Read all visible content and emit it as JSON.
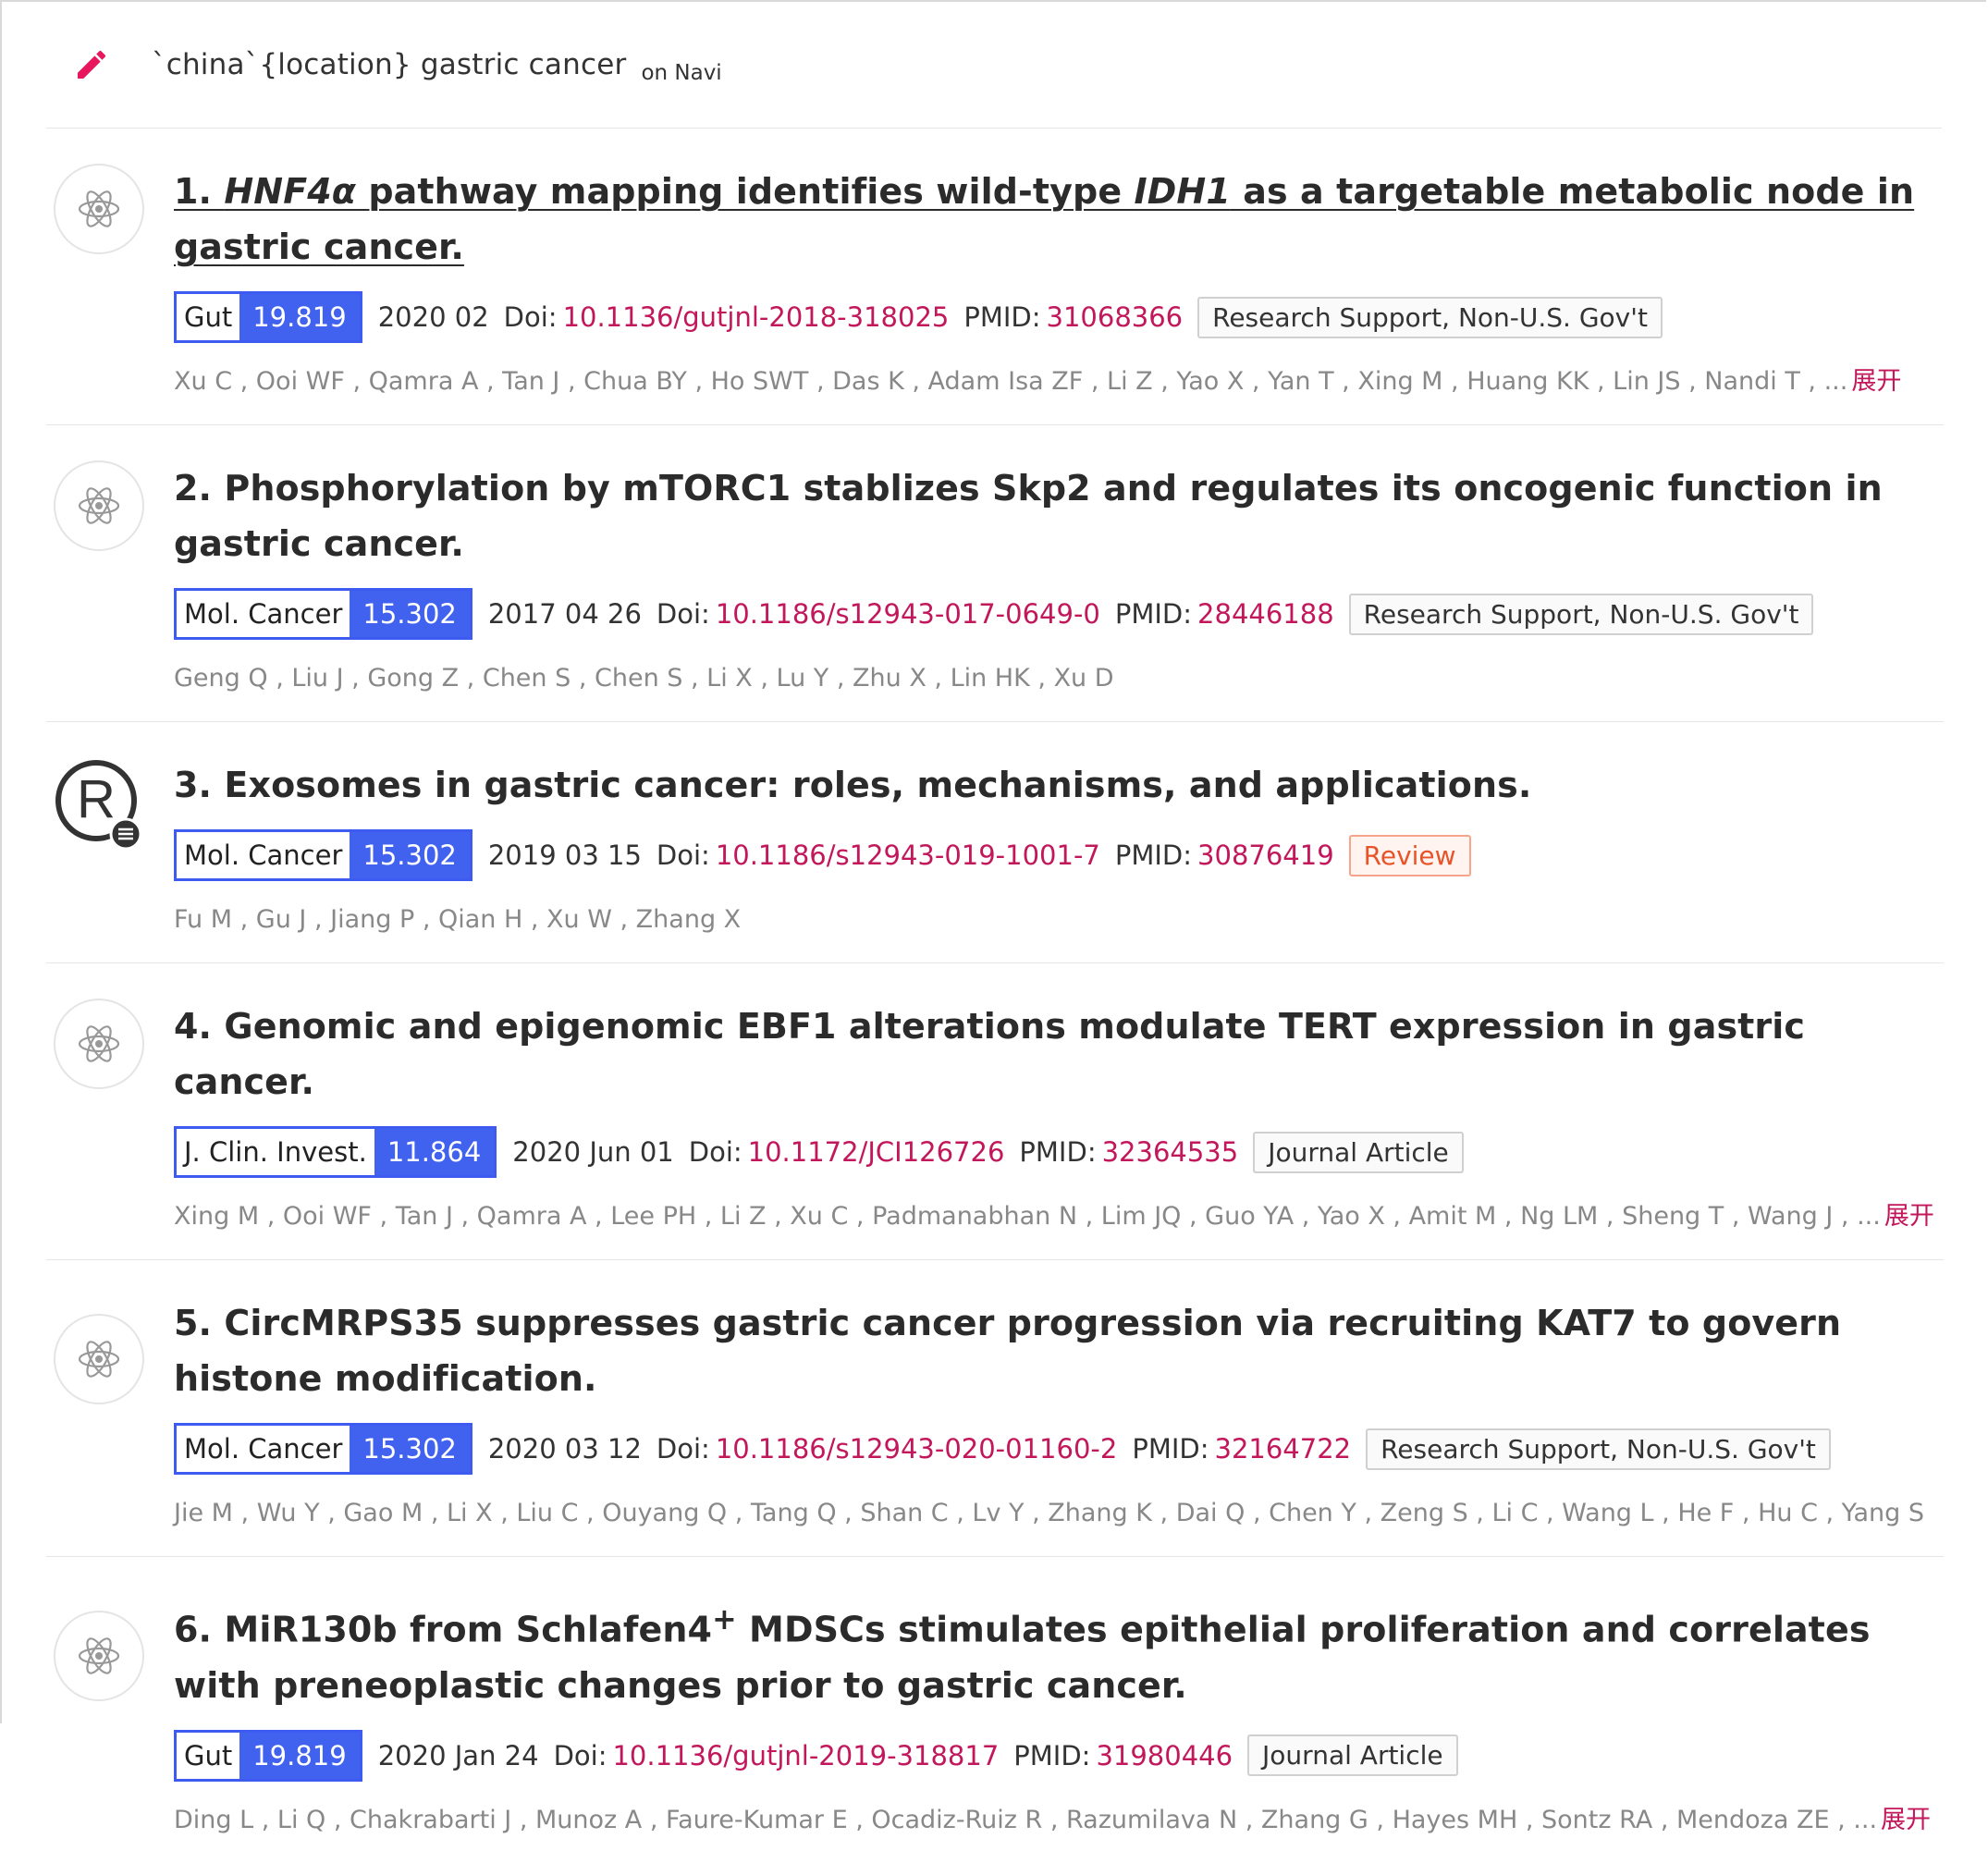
{
  "query": {
    "icon": "pencil-icon",
    "text": "`china`{location} gastric cancer",
    "suffix": "on Navi"
  },
  "colors": {
    "accent_red": "#e8175d",
    "journal_blue": "#4062ef",
    "link_crimson": "#c2185b",
    "muted_gray": "#888888"
  },
  "labels": {
    "doi": "Doi:",
    "pmid": "PMID:"
  },
  "results": [
    {
      "icon": "atom-icon",
      "title_parts": [
        {
          "t": "1. ",
          "style": "normal"
        },
        {
          "t": "HNF4α",
          "style": "italic"
        },
        {
          "t": " pathway mapping identifies wild-type ",
          "style": "normal"
        },
        {
          "t": "IDH1",
          "style": "italic"
        },
        {
          "t": " as a targetable metabolic node in ",
          "style": "normal"
        },
        {
          "t": "gastric cancer.",
          "style": "bold"
        }
      ],
      "linked": true,
      "journal": "Gut",
      "impact": "19.819",
      "date": "2020 02",
      "doi": "10.1136/gutjnl-2018-318025",
      "pmid": "31068366",
      "type": "Research Support, Non-U.S. Gov't",
      "type_style": "default",
      "authors": "Xu C , Ooi WF , Qamra A , Tan J , Chua BY , Ho SWT , Das K , Adam Isa ZF , Li Z , Yao X , Yan T , Xing M , Huang KK , Lin JS , Nandi T , ...",
      "expand": "展开"
    },
    {
      "icon": "atom-icon",
      "title_parts": [
        {
          "t": "2. Phosphorylation by mTORC1 stablizes Skp2 and regulates its oncogenic function in ",
          "style": "normal"
        },
        {
          "t": "gastric cancer.",
          "style": "bold"
        }
      ],
      "linked": false,
      "journal": "Mol. Cancer",
      "impact": "15.302",
      "date": "2017 04 26",
      "doi": "10.1186/s12943-017-0649-0",
      "pmid": "28446188",
      "type": "Research Support, Non-U.S. Gov't",
      "type_style": "default",
      "authors": "Geng Q , Liu J , Gong Z , Chen S , Chen S , Li X , Lu Y , Zhu X , Lin HK , Xu D",
      "expand": ""
    },
    {
      "icon": "review-registered-icon",
      "title_parts": [
        {
          "t": "3. Exosomes in ",
          "style": "normal"
        },
        {
          "t": "gastric cancer:",
          "style": "bold"
        },
        {
          "t": " roles, mechanisms, and applications.",
          "style": "normal"
        }
      ],
      "linked": false,
      "journal": "Mol. Cancer",
      "impact": "15.302",
      "date": "2019 03 15",
      "doi": "10.1186/s12943-019-1001-7",
      "pmid": "30876419",
      "type": "Review",
      "type_style": "review",
      "authors": "Fu M , Gu J , Jiang P , Qian H , Xu W , Zhang X",
      "expand": ""
    },
    {
      "icon": "atom-icon",
      "title_parts": [
        {
          "t": "4. Genomic and epigenomic EBF1 alterations modulate TERT expression in ",
          "style": "normal"
        },
        {
          "t": "gastric cancer.",
          "style": "bold"
        }
      ],
      "linked": false,
      "journal": "J. Clin. Invest.",
      "impact": "11.864",
      "date": "2020 Jun 01",
      "doi": "10.1172/JCI126726",
      "pmid": "32364535",
      "type": "Journal Article",
      "type_style": "default",
      "authors": "Xing M , Ooi WF , Tan J , Qamra A , Lee PH , Li Z , Xu C , Padmanabhan N , Lim JQ , Guo YA , Yao X , Amit M , Ng LM , Sheng T , Wang J , ...",
      "expand": "展开"
    },
    {
      "icon": "atom-icon",
      "title_parts": [
        {
          "t": "5. CircMRPS35 suppresses ",
          "style": "normal"
        },
        {
          "t": "gastric cancer",
          "style": "bold"
        },
        {
          "t": " progression via recruiting KAT7 to govern histone modification.",
          "style": "normal"
        }
      ],
      "linked": false,
      "journal": "Mol. Cancer",
      "impact": "15.302",
      "date": "2020 03 12",
      "doi": "10.1186/s12943-020-01160-2",
      "pmid": "32164722",
      "type": "Research Support, Non-U.S. Gov't",
      "type_style": "default",
      "authors": "Jie M , Wu Y , Gao M , Li X , Liu C , Ouyang Q , Tang Q , Shan C , Lv Y , Zhang K , Dai Q , Chen Y , Zeng S , Li C , Wang L , He F , Hu C , Yang S",
      "expand": ""
    },
    {
      "icon": "atom-icon",
      "title_parts": [
        {
          "t": "6. MiR130b from Schlafen4",
          "style": "normal"
        },
        {
          "t": "+",
          "style": "sup"
        },
        {
          "t": " MDSCs stimulates epithelial proliferation and correlates with preneoplastic changes prior to ",
          "style": "normal"
        },
        {
          "t": "gastric cancer.",
          "style": "bold"
        }
      ],
      "linked": false,
      "journal": "Gut",
      "impact": "19.819",
      "date": "2020 Jan 24",
      "doi": "10.1136/gutjnl-2019-318817",
      "pmid": "31980446",
      "type": "Journal Article",
      "type_style": "default",
      "authors": "Ding L , Li Q , Chakrabarti J , Munoz A , Faure-Kumar E , Ocadiz-Ruiz R , Razumilava N , Zhang G , Hayes MH , Sontz RA , Mendoza ZE , ...",
      "expand": "展开"
    }
  ]
}
